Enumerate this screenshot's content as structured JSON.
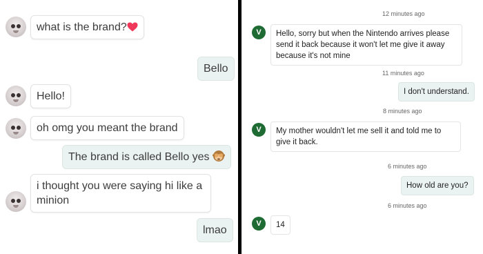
{
  "left_chat": {
    "messages": [
      {
        "side": "in",
        "text": "what is the brand?",
        "emoji": "heart-icon"
      },
      {
        "side": "out",
        "text": "Bello"
      },
      {
        "side": "in",
        "text": "Hello!"
      },
      {
        "side": "in",
        "text": "oh omg you meant the brand"
      },
      {
        "side": "out",
        "text": "The brand is called Bello yes",
        "emoji": "see-no-evil-monkey-icon"
      },
      {
        "side": "in",
        "text_line1": "i thought you were saying hi like a",
        "text_line2": "minion"
      },
      {
        "side": "out",
        "text": "lmao"
      }
    ]
  },
  "right_chat": {
    "contact_initial": "V",
    "accent_color": "#1f6b34",
    "timestamps": [
      "12 minutes ago",
      "11 minutes ago",
      "8 minutes ago",
      "6 minutes ago",
      "6 minutes ago"
    ],
    "messages": [
      {
        "side": "in",
        "line1": "Hello, sorry but when the Nintendo arrives please",
        "line2": "send it back because it won't let me give it away",
        "line3": "because it's not mine"
      },
      {
        "side": "out",
        "text": "I don't understand."
      },
      {
        "side": "in",
        "line1": "My mother wouldn't let me sell it and told me to",
        "line2": "give it back."
      },
      {
        "side": "out",
        "text": "How old are you?"
      },
      {
        "side": "in",
        "text": "14"
      }
    ]
  }
}
